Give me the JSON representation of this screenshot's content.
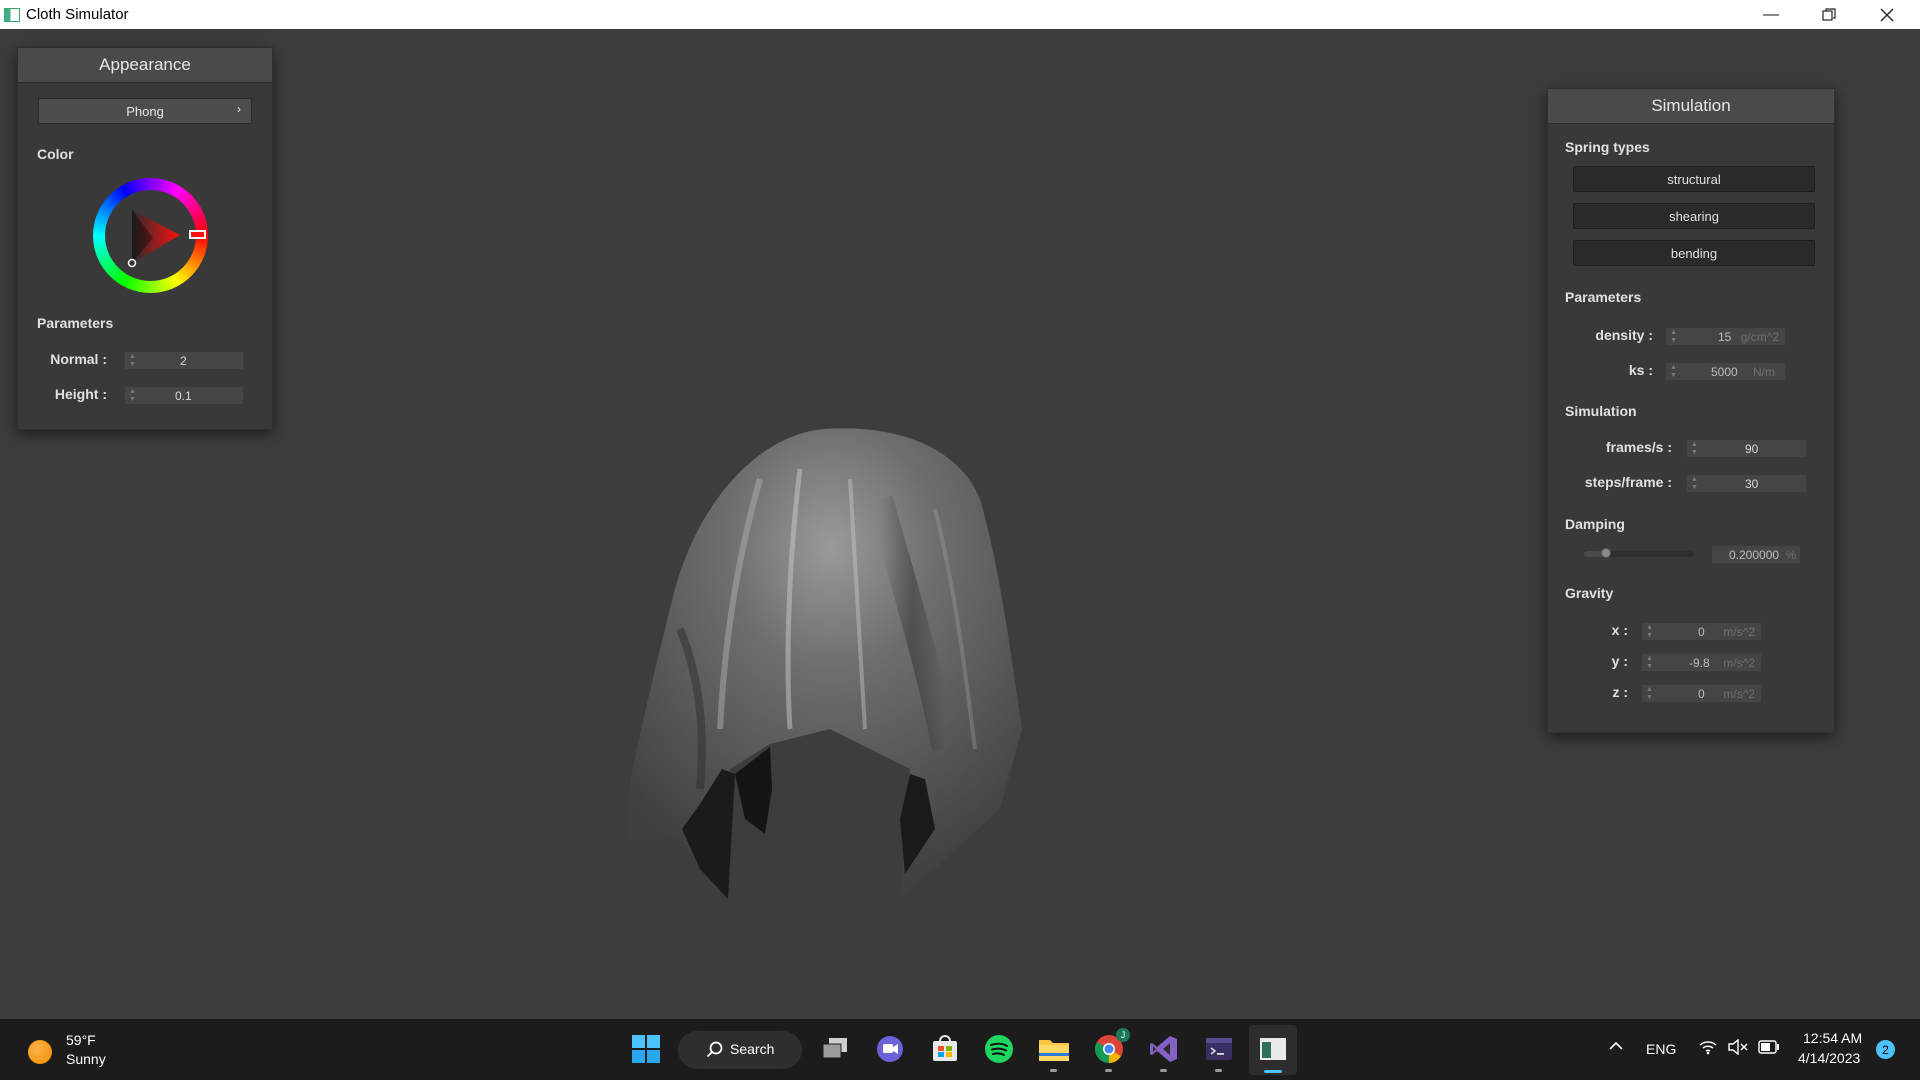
{
  "window": {
    "title": "Cloth Simulator"
  },
  "appearance": {
    "title": "Appearance",
    "shading_mode": "Phong",
    "color_label": "Color",
    "parameters_label": "Parameters",
    "normal_label": "Normal :",
    "normal_value": "2",
    "height_label": "Height :",
    "height_value": "0.1"
  },
  "simulation": {
    "title": "Simulation",
    "spring_types_label": "Spring types",
    "spring_buttons": [
      "structural",
      "shearing",
      "bending"
    ],
    "parameters_label": "Parameters",
    "density_label": "density :",
    "density_value": "15",
    "density_unit": "g/cm^2",
    "ks_label": "ks :",
    "ks_value": "5000",
    "ks_unit": "N/m",
    "simulation_label": "Simulation",
    "fps_label": "frames/s :",
    "fps_value": "90",
    "steps_label": "steps/frame :",
    "steps_value": "30",
    "damping_label": "Damping",
    "damping_value": "0.200000",
    "damping_unit": "%",
    "damping_slider_fraction": 0.2,
    "gravity_label": "Gravity",
    "gx_label": "x :",
    "gx_value": "0",
    "gy_label": "y :",
    "gy_value": "-9.8",
    "gz_label": "z :",
    "gz_value": "0",
    "gravity_unit": "m/s^2"
  },
  "taskbar": {
    "weather_temp": "59°F",
    "weather_desc": "Sunny",
    "search_label": "Search",
    "language": "ENG",
    "time": "12:54 AM",
    "date": "4/14/2023",
    "notification_count": "2",
    "chrome_badge": "J"
  },
  "colors": {
    "background": "#3d3d3d",
    "panel": "#393939",
    "taskbar": "#1c1c1c",
    "accent": "#4cc2ff"
  }
}
